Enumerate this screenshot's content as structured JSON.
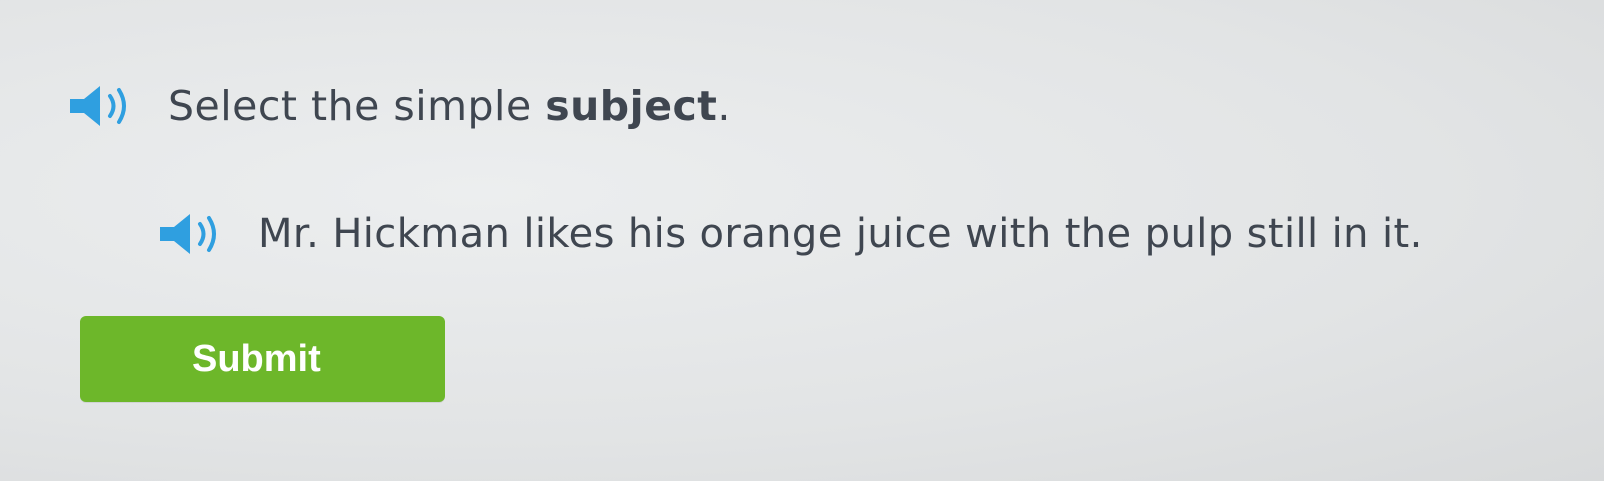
{
  "question": {
    "instruction_prefix": "Select the simple ",
    "instruction_emphasis": "subject",
    "instruction_suffix": ".",
    "sentence": "Mr. Hickman likes his orange juice with the pulp still in it."
  },
  "actions": {
    "submit_label": "Submit"
  },
  "icons": {
    "instruction_audio": "speaker-icon",
    "sentence_audio": "speaker-icon"
  },
  "colors": {
    "speaker_blue": "#2f9fe0",
    "submit_green": "#6db72a",
    "text": "#3f4650"
  }
}
